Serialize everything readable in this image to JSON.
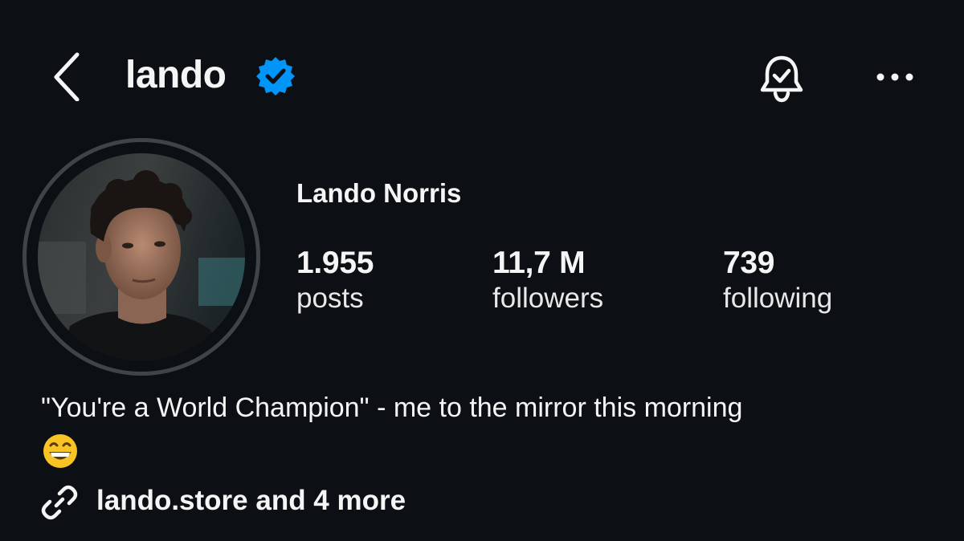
{
  "header": {
    "username": "lando",
    "verified": true,
    "icons": [
      "back-chevron-icon",
      "notification-bell-icon",
      "more-options-icon"
    ]
  },
  "profile": {
    "full_name": "Lando Norris",
    "stats": [
      {
        "value": "1.955",
        "label": "posts"
      },
      {
        "value": "11,7 M",
        "label": "followers"
      },
      {
        "value": "739",
        "label": "following"
      }
    ],
    "bio": "\"You're a World Champion\" - me to the mirror this morning",
    "bio_emoji": "grinning-face-emoji",
    "link": "lando.store and 4 more"
  },
  "colors": {
    "background": "#0c1014",
    "text": "#f5f5f5",
    "verified": "#0095f6",
    "avatar_ring": "#3f4449"
  }
}
